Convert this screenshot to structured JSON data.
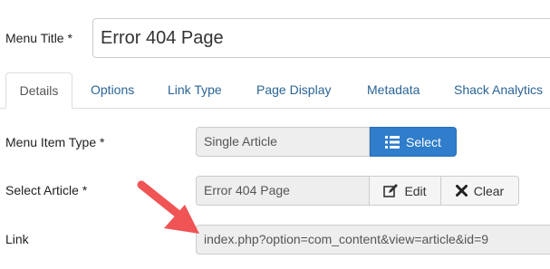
{
  "menu_title": {
    "label": "Menu Title *",
    "value": "Error 404 Page"
  },
  "tabs": [
    {
      "label": "Details",
      "active": true
    },
    {
      "label": "Options",
      "active": false
    },
    {
      "label": "Link Type",
      "active": false
    },
    {
      "label": "Page Display",
      "active": false
    },
    {
      "label": "Metadata",
      "active": false
    },
    {
      "label": "Shack Analytics",
      "active": false
    }
  ],
  "menu_item_type": {
    "label": "Menu Item Type *",
    "value": "Single Article",
    "select_label": "Select",
    "select_icon": "list-icon"
  },
  "select_article": {
    "label": "Select Article *",
    "value": "Error 404 Page",
    "edit_label": "Edit",
    "edit_icon": "edit-icon",
    "clear_label": "Clear",
    "clear_icon": "close-icon"
  },
  "link": {
    "label": "Link",
    "value": "index.php?option=com_content&view=article&id=9"
  },
  "annotation": {
    "icon": "arrow-pointer-icon",
    "color": "#f05454"
  },
  "colors": {
    "primary": "#2f7dcb",
    "tab_link": "#2a6496",
    "readonly_bg": "#eeeeee"
  }
}
